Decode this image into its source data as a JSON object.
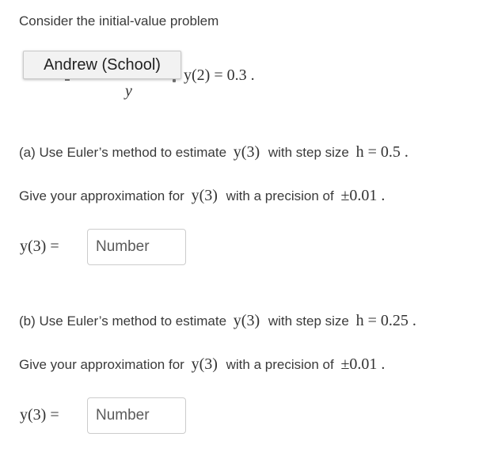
{
  "problem": {
    "intro": "Consider the initial-value problem",
    "fraction_denominator": "y",
    "initial_condition": "y(2) = 0.3 ."
  },
  "tooltip": {
    "label": "Andrew (School)"
  },
  "part_a": {
    "label": "(a) Use Euler’s method to estimate",
    "target": "y(3)",
    "step_text": "with step size",
    "step_math": "h = 0.5 .",
    "precision_text": "Give your approximation for",
    "precision_target": "y(3)",
    "precision_suffix": "with a precision of",
    "precision_value": "±0.01 .",
    "answer_label": "y(3) =",
    "input_placeholder": "Number",
    "input_value": ""
  },
  "part_b": {
    "label": "(b) Use Euler’s method to estimate",
    "target": "y(3)",
    "step_text": "with step size",
    "step_math": "h = 0.25 .",
    "precision_text": "Give your approximation for",
    "precision_target": "y(3)",
    "precision_suffix": "with a precision of",
    "precision_value": "±0.01 .",
    "answer_label": "y(3) =",
    "input_placeholder": "Number",
    "input_value": ""
  }
}
